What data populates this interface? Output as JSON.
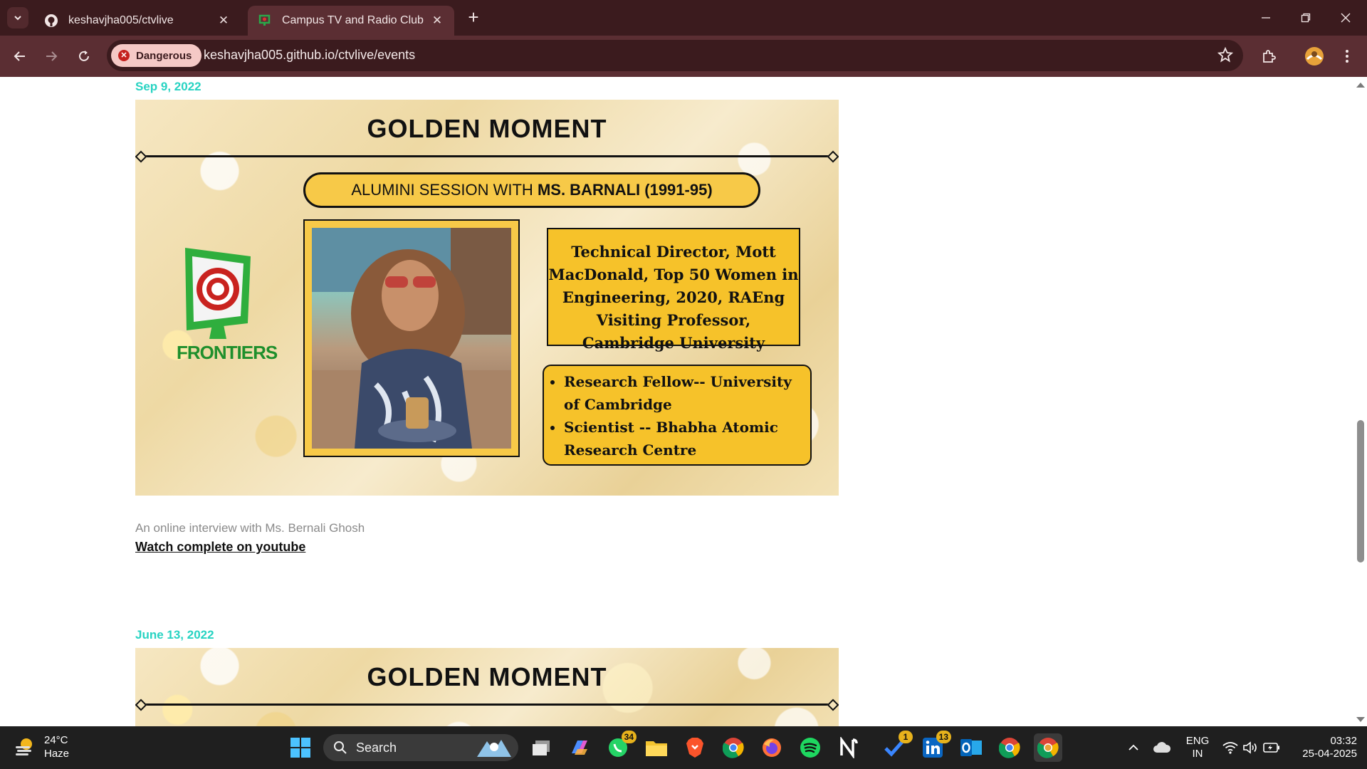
{
  "browser": {
    "tabs": [
      {
        "title": "keshavjha005/ctvlive",
        "active": false
      },
      {
        "title": "Campus TV and Radio Club",
        "active": true
      }
    ],
    "security_chip": "Dangerous",
    "url": "keshavjha005.github.io/ctvlive/events"
  },
  "events": [
    {
      "date": "Sep 9, 2022",
      "poster": {
        "heading": "GOLDEN MOMENT",
        "session_prefix": "ALUMINI SESSION WITH ",
        "session_name": "MS. BARNALI (1991-95)",
        "logo_text": "FRONTIERS",
        "bio": "Technical Director, Mott MacDonald, Top 50 Women in Engineering, 2020, RAEng Visiting Professor, Cambridge University",
        "bullets": [
          "Research Fellow-- University of Cambridge",
          "Scientist -- Bhabha Atomic Research Centre"
        ]
      },
      "description": "An online interview with Ms. Bernali Ghosh",
      "link_text": "Watch complete on youtube"
    },
    {
      "date": "June 13, 2022",
      "poster": {
        "heading": "GOLDEN MOMENT"
      }
    }
  ],
  "taskbar": {
    "weather": {
      "temp": "24°C",
      "condition": "Haze"
    },
    "search_placeholder": "Search",
    "badges": {
      "whatsapp": "34",
      "todo": "1",
      "linkedin": "13"
    },
    "language": {
      "line1": "ENG",
      "line2": "IN"
    },
    "time": "03:32",
    "date": "25-04-2025"
  },
  "colors": {
    "accent_date": "#27d3c2",
    "chrome_dark": "#3b1b1e",
    "chrome": "#5b2e33",
    "poster_yellow": "#f6c22a"
  }
}
